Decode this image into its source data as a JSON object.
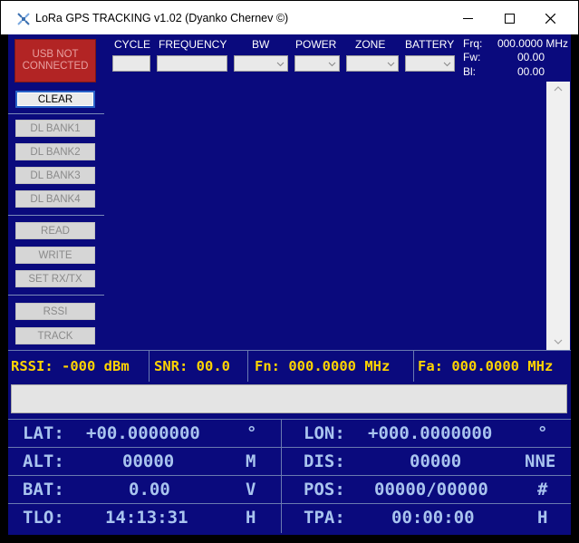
{
  "window": {
    "title": "LoRa GPS TRACKING v1.02  (Dyanko Chernev ©)"
  },
  "left_panel": {
    "usb_status": "USB NOT CONNECTED",
    "clear": "CLEAR",
    "dl_bank1": "DL BANK1",
    "dl_bank2": "DL BANK2",
    "dl_bank3": "DL BANK3",
    "dl_bank4": "DL BANK4",
    "read": "READ",
    "write": "WRITE",
    "set_rx_tx": "SET RX/TX",
    "rssi": "RSSI",
    "track": "TRACK"
  },
  "header": {
    "cycle": "CYCLE",
    "frequency": "FREQUENCY",
    "bw": "BW",
    "power": "POWER",
    "zone": "ZONE",
    "battery": "BATTERY",
    "frq_label": "Frq:",
    "frq_value": "000.0000 MHz",
    "fw_label": "Fw:",
    "fw_value": "00.00",
    "bl_label": "Bl:",
    "bl_value": "00.00"
  },
  "status": {
    "rssi": "RSSI: -000  dBm",
    "snr": "SNR: 00.0",
    "fn": "Fn: 000.0000 MHz",
    "fa": "Fa: 000.0000 MHz"
  },
  "grid": {
    "lat_label": "LAT:",
    "lat_value": "+00.0000000",
    "lat_unit": "°",
    "lon_label": "LON:",
    "lon_value": "+000.0000000",
    "lon_unit": "°",
    "alt_label": "ALT:",
    "alt_value": "00000",
    "alt_unit": "M",
    "dis_label": "DIS:",
    "dis_value": "00000",
    "dis_unit": "NNE",
    "bat_label": "BAT:",
    "bat_value": "0.00",
    "bat_unit": "V",
    "pos_label": "POS:",
    "pos_value": "00000/00000",
    "pos_unit": "#",
    "tlo_label": "TLO:",
    "tlo_value": "14:13:31",
    "tlo_unit": "H",
    "tpa_label": "TPA:",
    "tpa_value": "00:00:00",
    "tpa_unit": "H"
  },
  "colors": {
    "panel_bg": "#0a0a7d",
    "status_text": "#ffd400",
    "grid_text": "#a9c4ef",
    "usb_bg": "#b22424"
  }
}
